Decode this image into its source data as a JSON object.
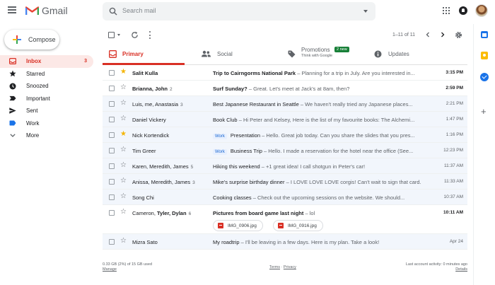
{
  "header": {
    "app_name": "Gmail",
    "search_placeholder": "Search mail"
  },
  "sidebar": {
    "compose_label": "Compose",
    "items": [
      {
        "label": "Inbox",
        "count": "3",
        "icon": "inbox-icon",
        "active": true
      },
      {
        "label": "Starred",
        "count": "",
        "icon": "star-icon"
      },
      {
        "label": "Snoozed",
        "count": "",
        "icon": "clock-icon"
      },
      {
        "label": "Important",
        "count": "",
        "icon": "important-icon"
      },
      {
        "label": "Sent",
        "count": "",
        "icon": "send-icon"
      },
      {
        "label": "Work",
        "count": "",
        "icon": "label-icon"
      },
      {
        "label": "More",
        "count": "",
        "icon": "chevron-down-icon"
      }
    ]
  },
  "toolbar": {
    "pager": "1–11 of 11"
  },
  "tabs": {
    "primary": "Primary",
    "social": "Social",
    "promotions": "Promotions",
    "promotions_badge": "2 new",
    "promotions_sub": "Think with Google",
    "updates": "Updates"
  },
  "emails": [
    {
      "sender": "Salit Kulla",
      "count": "",
      "label": "",
      "subject": "Trip to Cairngorms National Park",
      "snippet": " – Planning for a trip in July. Are you interested in...",
      "time": "3:15 PM",
      "unread": true,
      "starred": true
    },
    {
      "sender": "Brianna, John",
      "count": "2",
      "label": "",
      "subject": "Surf Sunday?",
      "snippet": " – Great. Let's meet at Jack's at 8am, then?",
      "time": "2:59 PM",
      "unread": true,
      "starred": false
    },
    {
      "sender": "Luis, me, Anastasia",
      "count": "3",
      "label": "",
      "subject": "Best Japanese Restaurant in Seattle",
      "snippet": " – We haven't really tried any Japanese places...",
      "time": "2:21 PM",
      "unread": false,
      "starred": false
    },
    {
      "sender": "Daniel Vickery",
      "count": "",
      "label": "",
      "subject": "Book Club",
      "snippet": " – Hi Peter and Kelsey, Here is the list of my favourite books: The Alchemi...",
      "time": "1:47 PM",
      "unread": false,
      "starred": false
    },
    {
      "sender": "Nick Kortendick",
      "count": "",
      "label": "Work",
      "subject": "Presentation",
      "snippet": " – Hello. Great job today. Can you share the slides that you pres...",
      "time": "1:16 PM",
      "unread": false,
      "starred": true
    },
    {
      "sender": "Tim Greer",
      "count": "",
      "label": "Work",
      "subject": "Business Trip",
      "snippet": " – Hello. I made a reservation for the hotel near the office (See...",
      "time": "12:23 PM",
      "unread": false,
      "starred": false
    },
    {
      "sender": "Karen, Meredith, James",
      "count": "5",
      "label": "",
      "subject": "Hiking this weekend",
      "snippet": " – +1 great idea! I call shotgun in Peter's car!",
      "time": "11:37 AM",
      "unread": false,
      "starred": false
    },
    {
      "sender": "Anissa, Meredith, James",
      "count": "3",
      "label": "",
      "subject": "Mike's surprise birthday dinner",
      "snippet": " – I LOVE LOVE LOVE corgis! Can't wait to sign that card.",
      "time": "11:33 AM",
      "unread": false,
      "starred": false
    },
    {
      "sender": "Song Chi",
      "count": "",
      "label": "",
      "subject": "Cooking classes",
      "snippet": " – Check out the upcoming sessions on the website. We should...",
      "time": "10:37 AM",
      "unread": false,
      "starred": false
    },
    {
      "sender": "Cameron, Tyler, Dylan",
      "count": "6",
      "label": "",
      "subject": "Pictures from board game last night",
      "snippet": " – lol",
      "time": "10:11 AM",
      "unread": true,
      "starred": false,
      "attachments": [
        "IMG_0906.jpg",
        "IMG_0916.jpg"
      ]
    },
    {
      "sender": "Mizra Sato",
      "count": "",
      "label": "",
      "subject": "My roadtrip",
      "snippet": " – I'll be leaving in a few days. Here is my plan. Take a look!",
      "time": "Apr 24",
      "unread": false,
      "starred": false
    }
  ],
  "footer": {
    "storage": "0.33 GB (2%) of 15 GB used",
    "manage": "Manage",
    "terms": "Terms",
    "separator": " · ",
    "privacy": "Privacy",
    "activity": "Last account activity: 0 minutes ago",
    "details": "Details"
  },
  "colors": {
    "accent": "#d93025",
    "star": "#f4b400",
    "badge": "#188038",
    "read_row": "#f2f6fc"
  }
}
